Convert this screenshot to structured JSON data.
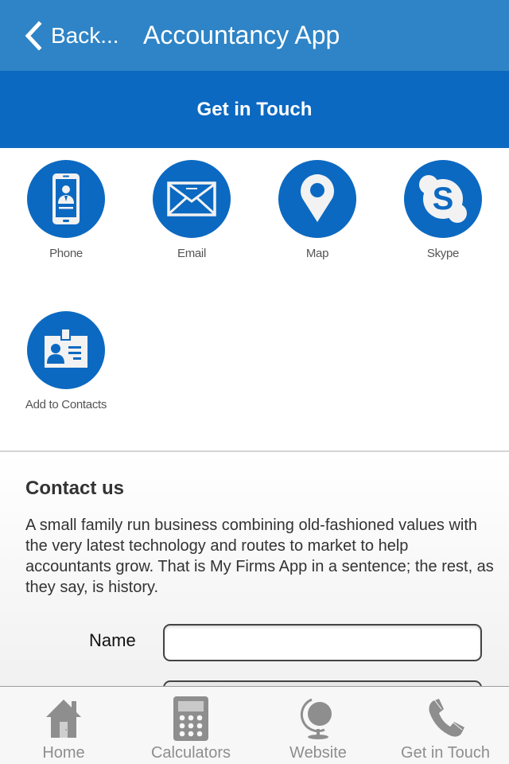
{
  "navbar": {
    "back_label": "Back...",
    "title": "Accountancy App"
  },
  "section": {
    "title": "Get in Touch"
  },
  "actions": [
    {
      "label": "Phone",
      "icon": "phone-contact-icon"
    },
    {
      "label": "Email",
      "icon": "envelope-icon"
    },
    {
      "label": "Map",
      "icon": "map-pin-icon"
    },
    {
      "label": "Skype",
      "icon": "skype-icon"
    },
    {
      "label": "Add to Contacts",
      "icon": "id-badge-icon"
    }
  ],
  "contact": {
    "title": "Contact us",
    "text": "A small family run business combining old-fashioned values with the very latest technology and routes to market to help accountants grow. That is My Firms App in a sentence; the rest, as they say, is history.",
    "form": {
      "name_label": "Name",
      "name_value": ""
    }
  },
  "tabbar": {
    "items": [
      {
        "label": "Home",
        "icon": "home-icon"
      },
      {
        "label": "Calculators",
        "icon": "calculator-icon"
      },
      {
        "label": "Website",
        "icon": "globe-icon"
      },
      {
        "label": "Get in Touch",
        "icon": "phone-handset-icon"
      }
    ]
  },
  "colors": {
    "navbar": "#2e84c6",
    "accent": "#0c69c1",
    "tab_inactive": "#8e8e8e"
  }
}
